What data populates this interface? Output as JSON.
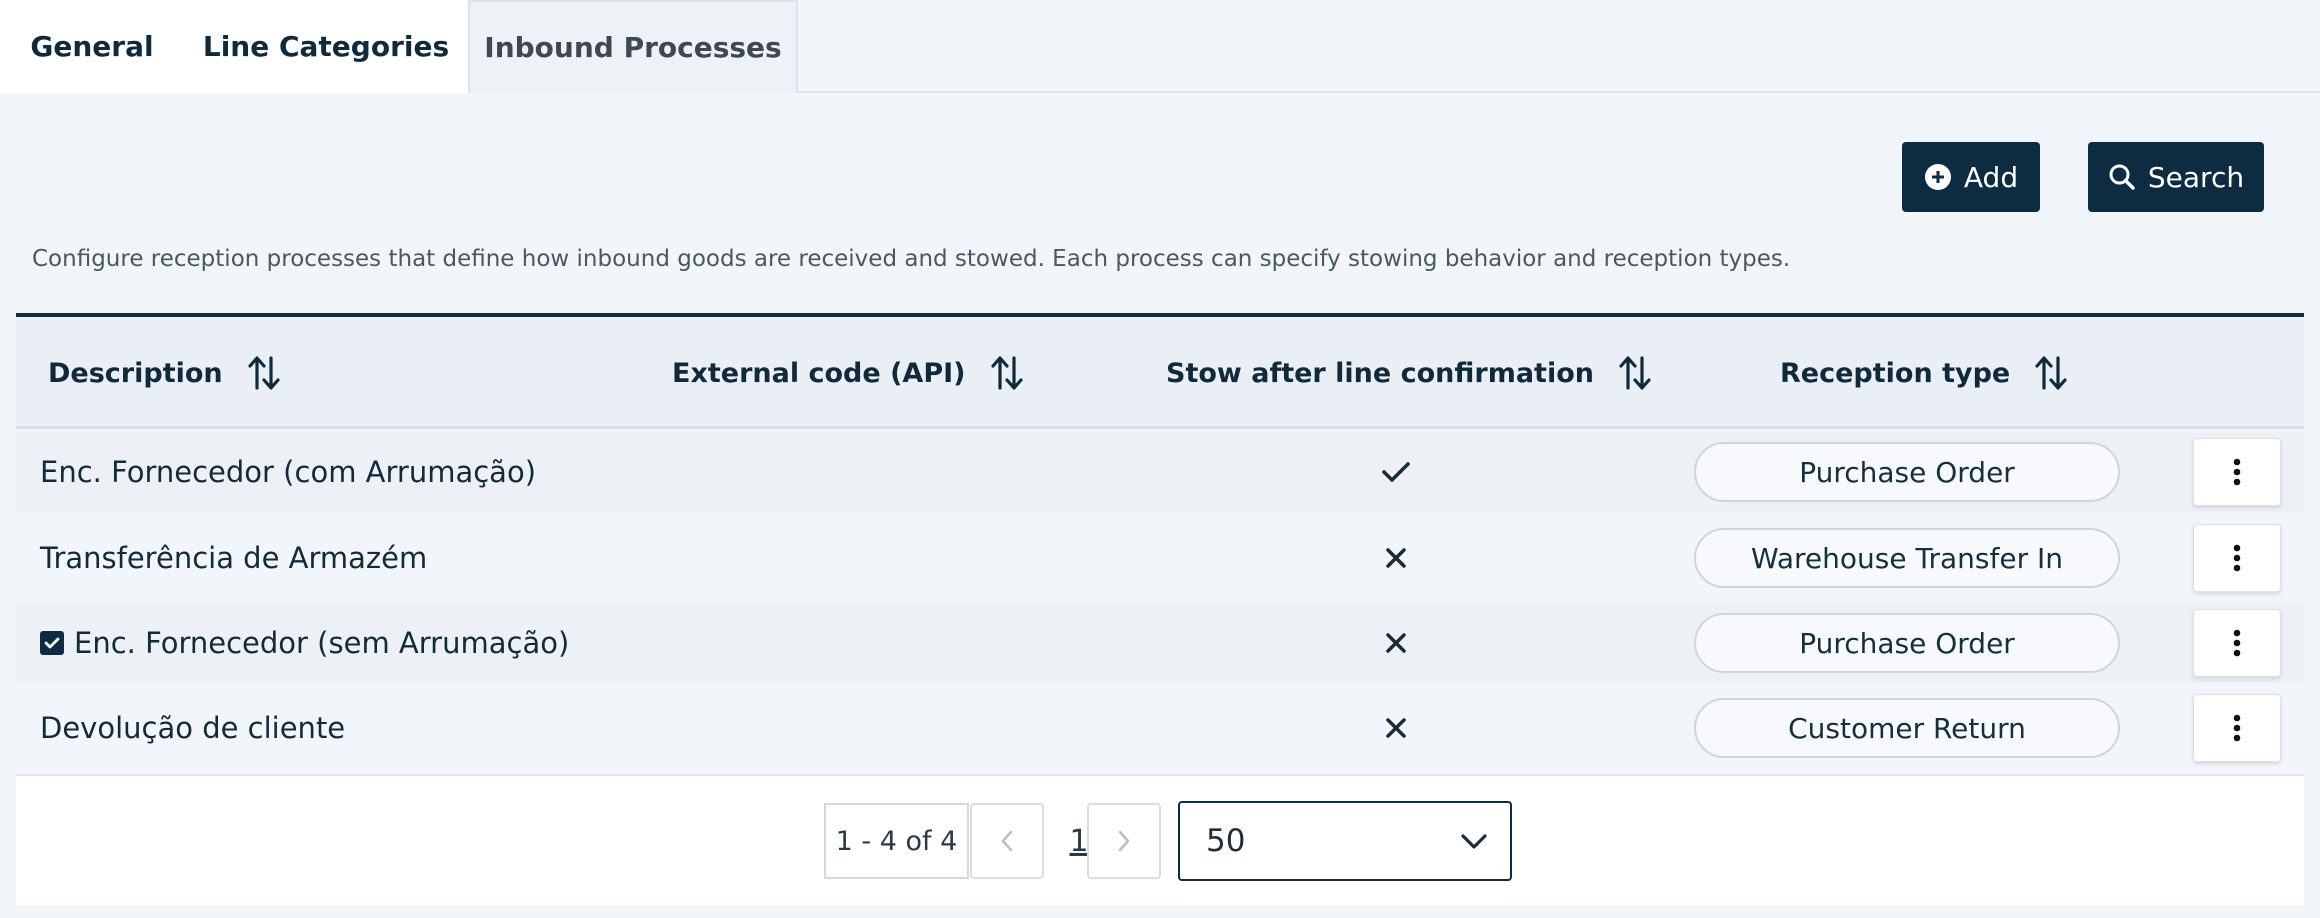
{
  "tabs": [
    {
      "label": "General"
    },
    {
      "label": "Line Categories"
    },
    {
      "label": "Inbound Processes",
      "active": true
    }
  ],
  "toolbar": {
    "add_label": "Add",
    "search_label": "Search"
  },
  "description": "Configure reception processes that define how inbound goods are received and stowed. Each process can specify stowing behavior and reception types.",
  "table": {
    "headers": {
      "description": "Description",
      "external_code": "External code (API)",
      "stow": "Stow after line confirmation",
      "reception_type": "Reception type"
    },
    "rows": [
      {
        "description": "Enc. Fornecedor (com Arrumação)",
        "stow": true,
        "reception_type": "Purchase Order",
        "selected": false
      },
      {
        "description": "Transferência de Armazém",
        "stow": false,
        "reception_type": "Warehouse Transfer In",
        "selected": false
      },
      {
        "description": "Enc. Fornecedor (sem Arrumação)",
        "stow": false,
        "reception_type": "Purchase Order",
        "selected": true
      },
      {
        "description": "Devolução de cliente",
        "stow": false,
        "reception_type": "Customer Return",
        "selected": false
      }
    ]
  },
  "pagination": {
    "range": "1 - 4 of 4",
    "current_page": "1",
    "page_size": "50"
  },
  "colors": {
    "primary": "#0d2b41",
    "background": "#f2f5f9"
  },
  "icons": {
    "add": "plus-circle-icon",
    "search": "search-icon",
    "sort": "sort-icon",
    "menu": "kebab-menu-icon"
  }
}
